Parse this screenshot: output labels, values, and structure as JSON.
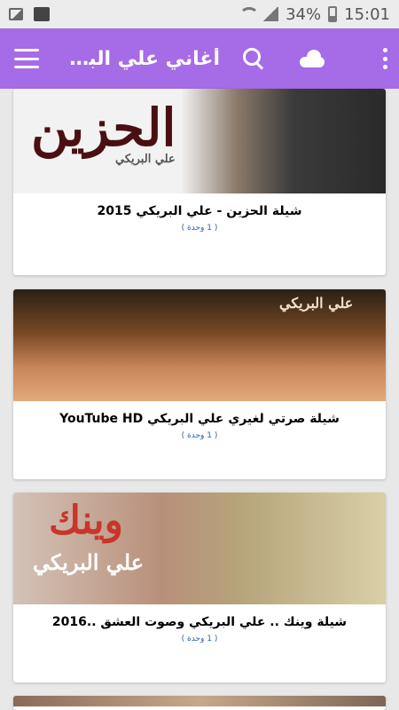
{
  "status_bar": {
    "battery": "34%",
    "time": "15:01"
  },
  "app_bar": {
    "title": "أغاني علي البريكي"
  },
  "items": [
    {
      "thumb_text": "الحزين",
      "thumb_sub": "علي البريكي",
      "title": "شيلة الحزين - علي البريكي 2015",
      "subtitle": "( 1 وحدة )"
    },
    {
      "thumb_text": "علي البريكي",
      "title": "شيلة صرتي لغيري علي البريكي YouTube HD",
      "subtitle": "( 1 وحدة )"
    },
    {
      "thumb_text": "وينك",
      "thumb_sub": "علي البريكي",
      "title": "شيلة وينك .. علي البريكي وصوت العشق ..2016",
      "subtitle": "( 1 وحدة )"
    }
  ],
  "colors": {
    "app_bar": "#a66be6",
    "accent_link": "#2a5db0"
  }
}
